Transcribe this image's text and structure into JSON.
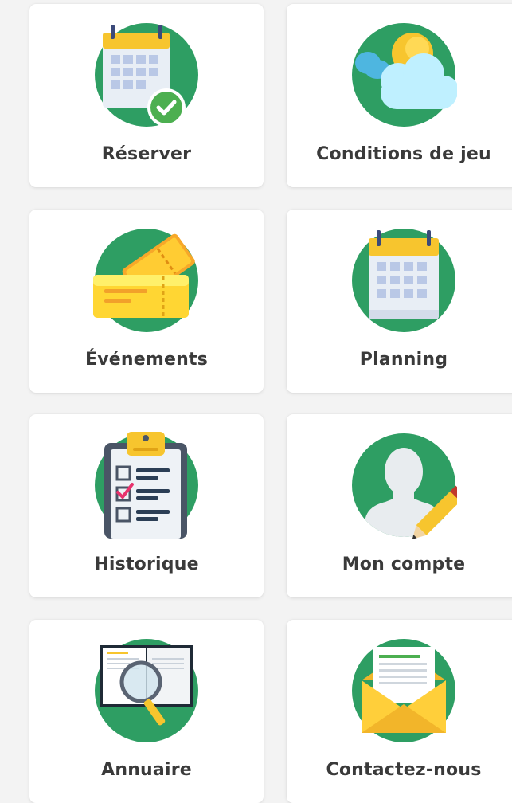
{
  "menu": {
    "tiles": [
      {
        "label": "Réserver",
        "icon": "calendar-check-icon"
      },
      {
        "label": "Conditions de jeu",
        "icon": "weather-icon"
      },
      {
        "label": "Événements",
        "icon": "tickets-icon"
      },
      {
        "label": "Planning",
        "icon": "calendar-icon"
      },
      {
        "label": "Historique",
        "icon": "clipboard-checklist-icon"
      },
      {
        "label": "Mon compte",
        "icon": "user-edit-icon"
      },
      {
        "label": "Annuaire",
        "icon": "directory-search-icon"
      },
      {
        "label": "Contactez-nous",
        "icon": "envelope-icon"
      }
    ]
  },
  "colors": {
    "circle_green": "#2e9e63",
    "yellow": "#f7c52e",
    "label_text": "#3a3a3a"
  }
}
